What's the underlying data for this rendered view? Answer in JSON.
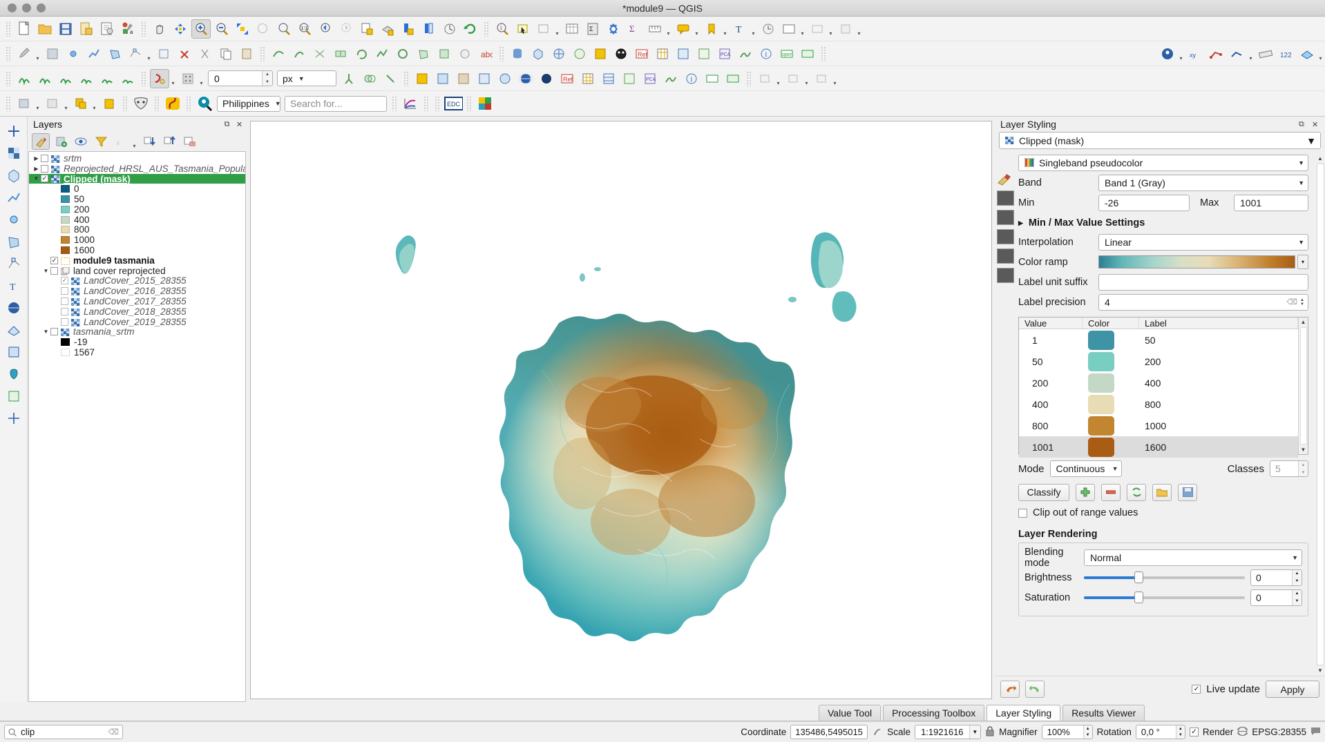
{
  "window": {
    "title": "*module9 — QGIS"
  },
  "toolbars": {
    "row3": {
      "value": "0",
      "unit": "px"
    },
    "row4": {
      "country": "Philippines",
      "search_placeholder": "Search for...",
      "edc_label": "EDC"
    }
  },
  "layers_panel": {
    "title": "Layers",
    "items": [
      {
        "name": "srtm",
        "indent": 0,
        "style": "it",
        "expander": "▶",
        "checked": false,
        "icon": "raster",
        "selected": false
      },
      {
        "name": "Reprojected_HRSL_AUS_Tasmania_Population",
        "indent": 0,
        "style": "it",
        "expander": "▶",
        "checked": false,
        "icon": "raster",
        "selected": false
      },
      {
        "name": "Clipped (mask)",
        "indent": 0,
        "style": "b",
        "expander": "▼",
        "checked": true,
        "icon": "raster",
        "selected": true
      },
      {
        "name": "0",
        "indent": 2,
        "swatch": "#0d5b82",
        "checked": null
      },
      {
        "name": "50",
        "indent": 2,
        "swatch": "#3a92a5",
        "checked": null
      },
      {
        "name": "200",
        "indent": 2,
        "swatch": "#79cfc2",
        "checked": null
      },
      {
        "name": "400",
        "indent": 2,
        "swatch": "#c3d9c5",
        "checked": null
      },
      {
        "name": "800",
        "indent": 2,
        "swatch": "#e6dbb3",
        "checked": null
      },
      {
        "name": "1000",
        "indent": 2,
        "swatch": "#bf8530",
        "checked": null
      },
      {
        "name": "1600",
        "indent": 2,
        "swatch": "#a85a14",
        "checked": null
      },
      {
        "name": "module9 tasmania",
        "indent": 1,
        "style": "b",
        "checked": true,
        "icon": "vector-outline"
      },
      {
        "name": "land cover reprojected",
        "indent": 1,
        "expander": "▼",
        "checked": false,
        "icon": "group"
      },
      {
        "name": "LandCover_2015_28355",
        "indent": 2,
        "style": "it",
        "checked": true,
        "dim": true,
        "icon": "raster"
      },
      {
        "name": "LandCover_2016_28355",
        "indent": 2,
        "style": "it",
        "checked": false,
        "dim": true,
        "icon": "raster"
      },
      {
        "name": "LandCover_2017_28355",
        "indent": 2,
        "style": "it",
        "checked": false,
        "dim": true,
        "icon": "raster"
      },
      {
        "name": "LandCover_2018_28355",
        "indent": 2,
        "style": "it",
        "checked": false,
        "dim": true,
        "icon": "raster"
      },
      {
        "name": "LandCover_2019_28355",
        "indent": 2,
        "style": "it",
        "checked": false,
        "dim": true,
        "icon": "raster"
      },
      {
        "name": "tasmania_srtm",
        "indent": 1,
        "style": "it",
        "expander": "▼",
        "checked": false,
        "icon": "raster"
      },
      {
        "name": "-19",
        "indent": 2,
        "swatch": "#000000",
        "checked": null
      },
      {
        "name": "1567",
        "indent": 2,
        "swatch": "#ffffff",
        "checked": null
      }
    ]
  },
  "layer_styling": {
    "title": "Layer Styling",
    "layer_name": "Clipped (mask)",
    "renderer": "Singleband pseudocolor",
    "band_label": "Band",
    "band_value": "Band 1 (Gray)",
    "min_label": "Min",
    "min_value": "-26",
    "max_label": "Max",
    "max_value": "1001",
    "minmax_section": "Min / Max Value Settings",
    "interpolation_label": "Interpolation",
    "interpolation_value": "Linear",
    "color_ramp_label": "Color ramp",
    "label_unit_suffix_label": "Label unit suffix",
    "label_unit_suffix_value": "",
    "label_precision_label": "Label precision",
    "label_precision_value": "4",
    "table": {
      "headers": [
        "Value",
        "Color",
        "Label"
      ],
      "rows": [
        {
          "value": "1",
          "color": "#3e93a4",
          "label": "50",
          "selected": false
        },
        {
          "value": "50",
          "color": "#78cec1",
          "label": "200",
          "selected": false
        },
        {
          "value": "200",
          "color": "#c3d8c5",
          "label": "400",
          "selected": false
        },
        {
          "value": "400",
          "color": "#e7dcb4",
          "label": "800",
          "selected": false
        },
        {
          "value": "800",
          "color": "#c1862f",
          "label": "1000",
          "selected": false
        },
        {
          "value": "1001",
          "color": "#a85c14",
          "label": "1600",
          "selected": true
        }
      ]
    },
    "mode_label": "Mode",
    "mode_value": "Continuous",
    "classes_label": "Classes",
    "classes_value": "5",
    "classify_label": "Classify",
    "clip_out_of_range": "Clip out of range values",
    "layer_rendering_title": "Layer Rendering",
    "blending_label": "Blending mode",
    "blending_value": "Normal",
    "brightness_label": "Brightness",
    "brightness_value": "0",
    "saturation_label": "Saturation",
    "saturation_value": "0",
    "live_update_label": "Live update",
    "apply_label": "Apply"
  },
  "bottom_tabs": [
    {
      "label": "Value Tool",
      "active": false
    },
    {
      "label": "Processing Toolbox",
      "active": false
    },
    {
      "label": "Layer Styling",
      "active": true
    },
    {
      "label": "Results Viewer",
      "active": false
    }
  ],
  "status_bar": {
    "search_value": "clip",
    "coordinate_label": "Coordinate",
    "coordinate_value": "135486,5495015",
    "scale_label": "Scale",
    "scale_value": "1:1921616",
    "magnifier_label": "Magnifier",
    "magnifier_value": "100%",
    "rotation_label": "Rotation",
    "rotation_value": "0,0 °",
    "render_label": "Render",
    "crs_label": "EPSG:28355"
  },
  "colors": {
    "accent_green": "#2f9e44",
    "accent_blue": "#2b7bd4",
    "ramp_low": "#0d5b82",
    "ramp_high": "#a85a14"
  }
}
